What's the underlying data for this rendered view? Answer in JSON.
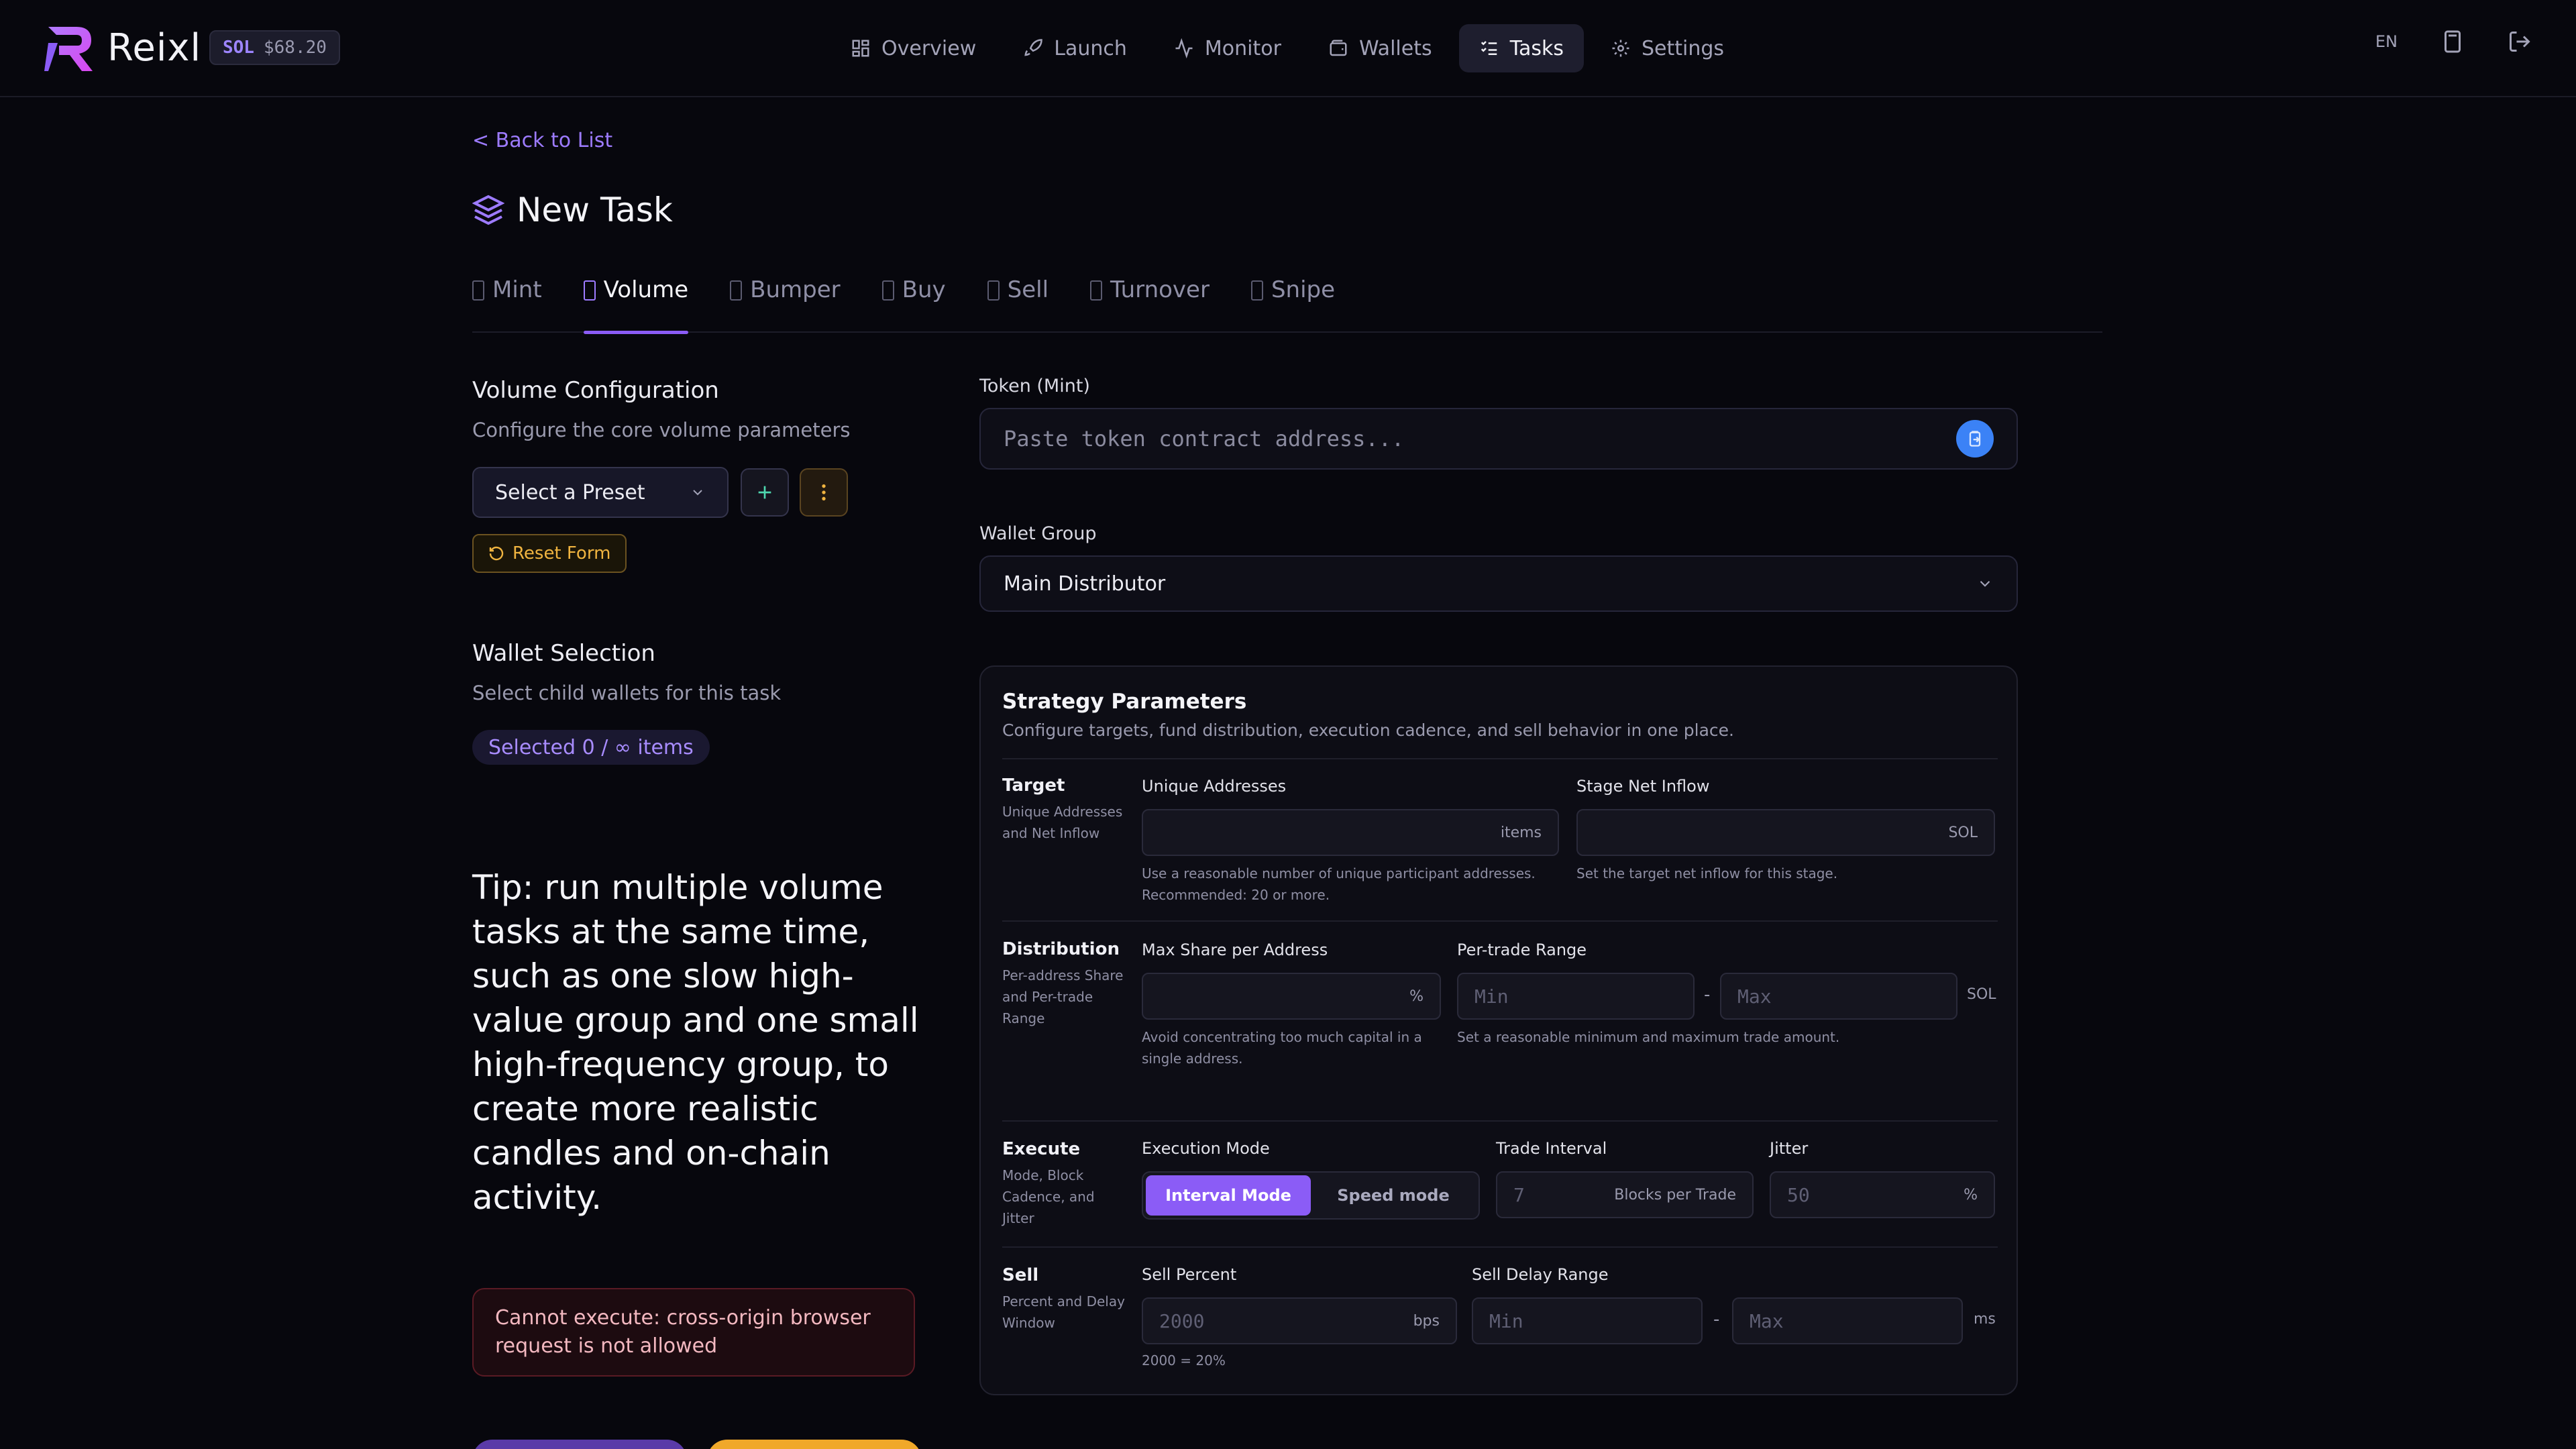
{
  "app": {
    "name": "Reixl",
    "sol_symbol": "SOL",
    "sol_price": "$68.20"
  },
  "nav": [
    {
      "label": "Overview",
      "icon": "grid-icon"
    },
    {
      "label": "Launch",
      "icon": "rocket-icon"
    },
    {
      "label": "Monitor",
      "icon": "activity-icon"
    },
    {
      "label": "Wallets",
      "icon": "wallet-icon"
    },
    {
      "label": "Tasks",
      "icon": "list-checks-icon",
      "active": true
    },
    {
      "label": "Settings",
      "icon": "gear-icon"
    }
  ],
  "header_right": {
    "lang": "EN",
    "calc_icon": "calculator-icon",
    "logout_icon": "logout-icon"
  },
  "page": {
    "back_label": "< Back to List",
    "title": "New Task"
  },
  "tabs": [
    {
      "label": "Mint"
    },
    {
      "label": "Volume",
      "active": true
    },
    {
      "label": "Bumper"
    },
    {
      "label": "Buy"
    },
    {
      "label": "Sell"
    },
    {
      "label": "Turnover"
    },
    {
      "label": "Snipe"
    }
  ],
  "left": {
    "config_title": "Volume Configuration",
    "config_sub": "Configure the core volume parameters",
    "preset_placeholder": "Select a Preset",
    "reset_label": "Reset Form",
    "wallet_title": "Wallet Selection",
    "wallet_sub": "Select child wallets for this task",
    "selected_label": "Selected 0 / ∞ items",
    "tip": "Tip: run multiple volume tasks at the same time, such as one slow high-value group and one small high-frequency group, to create more realistic candles and on-chain activity.",
    "error": "Cannot execute: cross-origin browser request is not allowed"
  },
  "right": {
    "token_label": "Token (Mint)",
    "token_placeholder": "Paste token contract address...",
    "wallet_group_label": "Wallet Group",
    "wallet_group_value": "Main Distributor"
  },
  "strategy": {
    "title": "Strategy Parameters",
    "subtitle": "Configure targets, fund distribution, execution cadence, and sell behavior in one place.",
    "target": {
      "title": "Target",
      "desc": "Unique Addresses and Net Inflow",
      "unique_label": "Unique Addresses",
      "unique_unit": "items",
      "unique_help": "Use a reasonable number of unique participant addresses. Recommended: 20 or more.",
      "inflow_label": "Stage Net Inflow",
      "inflow_unit": "SOL",
      "inflow_help": "Set the target net inflow for this stage."
    },
    "distribution": {
      "title": "Distribution",
      "desc": "Per-address Share and Per-trade Range",
      "share_label": "Max Share per Address",
      "share_unit": "%",
      "share_help": "Avoid concentrating too much capital in a single address.",
      "range_label": "Per-trade Range",
      "min_placeholder": "Min",
      "max_placeholder": "Max",
      "dash": "-",
      "range_unit": "SOL",
      "range_help": "Set a reasonable minimum and maximum trade amount."
    },
    "execute": {
      "title": "Execute",
      "desc": "Mode, Block Cadence, and Jitter",
      "mode_label": "Execution Mode",
      "mode_interval": "Interval Mode",
      "mode_speed": "Speed mode",
      "interval_label": "Trade Interval",
      "interval_placeholder": "7",
      "interval_unit": "Blocks per Trade",
      "jitter_label": "Jitter",
      "jitter_placeholder": "50",
      "jitter_unit": "%"
    },
    "sell": {
      "title": "Sell",
      "desc": "Percent and Delay Window",
      "percent_label": "Sell Percent",
      "percent_placeholder": "2000",
      "percent_unit": "bps",
      "percent_help": "2000 = 20%",
      "delay_label": "Sell Delay Range",
      "min_placeholder": "Min",
      "max_placeholder": "Max",
      "dash": "-",
      "delay_unit": "ms"
    }
  }
}
